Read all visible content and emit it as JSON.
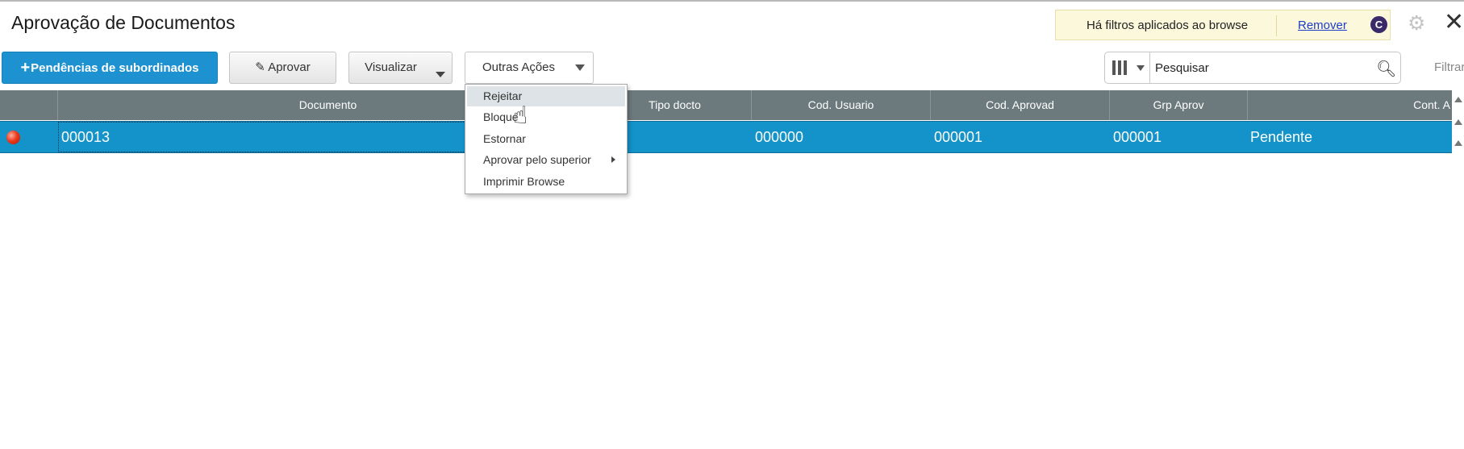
{
  "page": {
    "title": "Aprovação de Documentos"
  },
  "filter_notice": {
    "text": "Há filtros aplicados ao browse",
    "action_label": "Remover"
  },
  "header_icons": {
    "help": "help-icon",
    "settings": "gear-icon",
    "close": "close-icon"
  },
  "toolbar": {
    "pendencias_label": "Pendências de subordinados",
    "aprovar_label": "Aprovar",
    "visualizar_label": "Visualizar",
    "outras_acoes_label": "Outras Ações"
  },
  "search": {
    "placeholder": "Pesquisar",
    "filter_label": "Filtrar"
  },
  "grid": {
    "columns": [
      "Documento",
      "Tipo docto",
      "Cod. Usuario",
      "Cod. Aprovad",
      "Grp Aprov",
      "Cont. A"
    ],
    "rows": [
      {
        "status": "red",
        "documento": "000013",
        "tipo_docto": "",
        "cod_usuario": "000000",
        "cod_aprovad": "000001",
        "grp_aprov": "000001",
        "situacao": "Pendente"
      }
    ]
  },
  "menu": {
    "items": [
      {
        "label": "Rejeitar"
      },
      {
        "label": "Bloque"
      },
      {
        "label": "Estornar"
      },
      {
        "label": "Aprovar pelo superior"
      },
      {
        "label": "Imprimir Browse"
      }
    ]
  },
  "colors": {
    "primary_button": "#1e91d0",
    "header_bg": "#6d7a7d",
    "selected_row": "#1393c9",
    "filter_notice_bg": "#fcf8dc",
    "status_red": "#ee3a1c"
  }
}
